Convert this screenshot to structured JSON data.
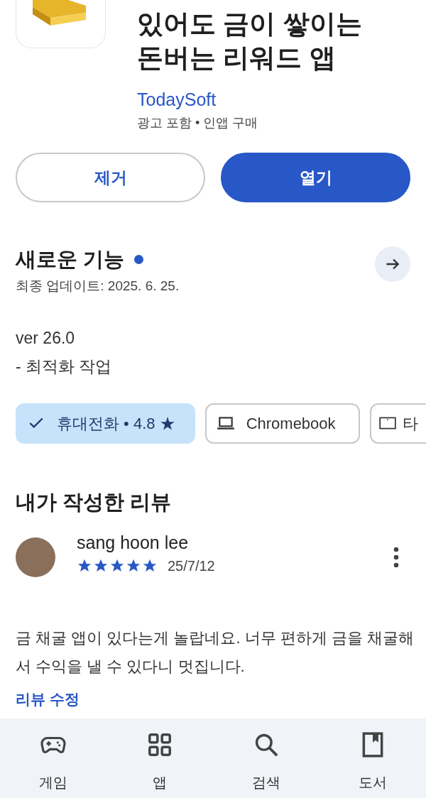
{
  "app": {
    "title_lines": [
      "있어도 금이 쌓이는",
      "돈버는 리워드 앱"
    ],
    "developer": "TodaySoft",
    "notes": "광고 포함 • 인앱 구매"
  },
  "buttons": [
    {
      "label": "제거",
      "kind": "outline"
    },
    {
      "label": "열기",
      "kind": "filled"
    }
  ],
  "whats_new": {
    "title": "새로운 기능",
    "updated": "최종 업데이트: 2025. 6. 25.",
    "lines": [
      "ver 26.0",
      "- 최적화 작업"
    ]
  },
  "devices": [
    {
      "label": "휴대전화 • 4.8 ★",
      "kind": "phone",
      "selected": true
    },
    {
      "label": "Chromebook",
      "kind": "laptop",
      "selected": false
    },
    {
      "label": "타",
      "kind": "tablet",
      "selected": false
    }
  ],
  "my_review": {
    "title": "내가 작성한 리뷰",
    "author": "sang hoon lee",
    "stars": 5,
    "date": "25/7/12",
    "text": "금 채굴 앱이 있다는게 놀랍네요. 너무 편하게 금을 채굴해서 수익을 낼 수 있다니 멋집니다.",
    "edit_link": "리뷰 수정"
  },
  "bottom_nav": [
    {
      "label": "게임",
      "kind": "games"
    },
    {
      "label": "앱",
      "kind": "apps"
    },
    {
      "label": "검색",
      "kind": "search"
    },
    {
      "label": "도서",
      "kind": "books"
    }
  ]
}
